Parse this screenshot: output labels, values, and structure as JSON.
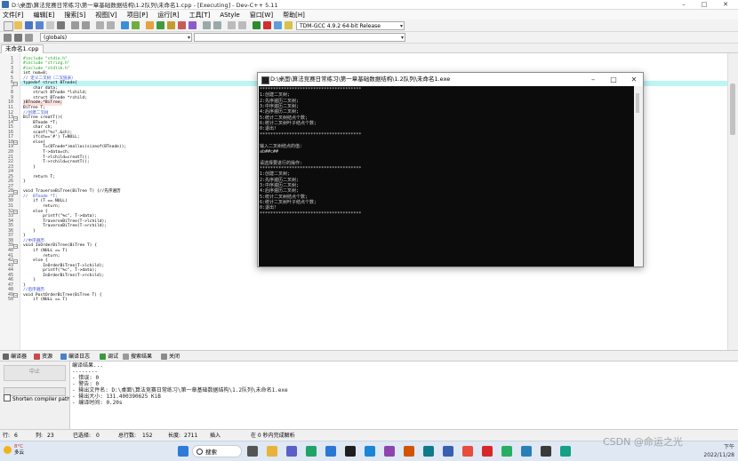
{
  "window": {
    "title": "D:\\桌面\\算法竞赛日常练习\\第一章基础数据结构\\1.2队列\\未命名1.cpp - [Executing] - Dev-C++ 5.11"
  },
  "menu": [
    "文件[F]",
    "编辑[E]",
    "搜索[S]",
    "视图[V]",
    "项目[P]",
    "运行[R]",
    "工具[T]",
    "AStyle",
    "窗口[W]",
    "帮助[H]"
  ],
  "toolbar": {
    "compiler": "TDM-GCC 4.9.2 64-bit Release",
    "scope": "(globals)"
  },
  "file_tab": "未命名1.cpp",
  "editor": {
    "lines": [
      {
        "n": "1",
        "t": "#include \"stdio.h\"",
        "c": "pp"
      },
      {
        "n": "2",
        "t": "#include \"string.h\"",
        "c": "pp"
      },
      {
        "n": "3",
        "t": "#include \"stdlib.h\"",
        "c": "pp"
      },
      {
        "n": "4",
        "t": "int num=0;",
        "c": ""
      },
      {
        "n": "5",
        "t": "// 定义二叉树（二叉链表）",
        "c": "cmt"
      },
      {
        "n": "6",
        "t": "typedef struct BTnode{",
        "c": "hl"
      },
      {
        "n": "7",
        "t": "    char data;",
        "c": ""
      },
      {
        "n": "8",
        "t": "    struct BTnode *lchild;",
        "c": ""
      },
      {
        "n": "9",
        "t": "    struct BTnode *rchild;",
        "c": ""
      },
      {
        "n": "10",
        "t": "}BTnode,*BiTree;",
        "c": "bp"
      },
      {
        "n": "11",
        "t": "BiTree T;",
        "c": ""
      },
      {
        "n": "12",
        "t": "//创建二叉树",
        "c": "cmt"
      },
      {
        "n": "13",
        "t": "BiTree creatT(){",
        "c": ""
      },
      {
        "n": "14",
        "t": "    BTnode *T;",
        "c": ""
      },
      {
        "n": "15",
        "t": "    char ch;",
        "c": ""
      },
      {
        "n": "16",
        "t": "    scanf(\"%c\",&ch);",
        "c": ""
      },
      {
        "n": "17",
        "t": "    if(ch=='#') T=NULL;",
        "c": ""
      },
      {
        "n": "18",
        "t": "    else{",
        "c": ""
      },
      {
        "n": "19",
        "t": "        T=(BTnode*)malloc(sizeof(BTnode));",
        "c": ""
      },
      {
        "n": "20",
        "t": "        T->data=ch;",
        "c": ""
      },
      {
        "n": "21",
        "t": "        T->lchild=creatT();",
        "c": ""
      },
      {
        "n": "22",
        "t": "        T->rchild=creatT();",
        "c": ""
      },
      {
        "n": "23",
        "t": "    }",
        "c": ""
      },
      {
        "n": "24",
        "t": "",
        "c": ""
      },
      {
        "n": "25",
        "t": "    return T;",
        "c": ""
      },
      {
        "n": "26",
        "t": "}",
        "c": ""
      },
      {
        "n": "27",
        "t": "",
        "c": ""
      },
      {
        "n": "28",
        "t": "void TraverseBiTree(BiTree T) {//先序遍历",
        "c": ""
      },
      {
        "n": "29",
        "t": "//  BTnode *T;",
        "c": "cmt"
      },
      {
        "n": "30",
        "t": "    if (T == NULL)",
        "c": ""
      },
      {
        "n": "31",
        "t": "        return;",
        "c": ""
      },
      {
        "n": "32",
        "t": "    else {",
        "c": ""
      },
      {
        "n": "33",
        "t": "        printf(\"%c\", T->data);",
        "c": ""
      },
      {
        "n": "34",
        "t": "        TraverseBiTree(T->lchild);",
        "c": ""
      },
      {
        "n": "35",
        "t": "        TraverseBiTree(T->rchild);",
        "c": ""
      },
      {
        "n": "36",
        "t": "    }",
        "c": ""
      },
      {
        "n": "37",
        "t": "}",
        "c": ""
      },
      {
        "n": "38",
        "t": "//中序遍历",
        "c": "cmt"
      },
      {
        "n": "39",
        "t": "void InOrderBiTree(BiTree T) {",
        "c": ""
      },
      {
        "n": "40",
        "t": "    if (NULL == T)",
        "c": ""
      },
      {
        "n": "41",
        "t": "        return;",
        "c": ""
      },
      {
        "n": "42",
        "t": "    else {",
        "c": ""
      },
      {
        "n": "43",
        "t": "        InOrderBiTree(T->lchild);",
        "c": ""
      },
      {
        "n": "44",
        "t": "        printf(\"%c\", T->data);",
        "c": ""
      },
      {
        "n": "45",
        "t": "        InOrderBiTree(T->rchild);",
        "c": ""
      },
      {
        "n": "46",
        "t": "    }",
        "c": ""
      },
      {
        "n": "47",
        "t": "}",
        "c": ""
      },
      {
        "n": "48",
        "t": "//后序遍历",
        "c": "cmt"
      },
      {
        "n": "49",
        "t": "void PostOrderBiTree(BiTree T) {",
        "c": ""
      },
      {
        "n": "50",
        "t": "    if (NULL == T)",
        "c": ""
      }
    ]
  },
  "console": {
    "title": "D:\\桌面\\算法竞赛日常练习\\第一章基础数据结构\\1.2队列\\未命名1.exe",
    "lines": [
      "**************************************",
      "1:创建二叉树;",
      "2:先序遍历二叉树;",
      "3:中序遍历二叉树;",
      "4:后序遍历二叉树;",
      "5:统计二叉树结点个数;",
      "6:统计二叉树叶子结点个数;",
      "0:退出!",
      "**************************************",
      "",
      "输入二叉树结点的值:",
      "ab##c##",
      "",
      "请选择要进行的操作:",
      "**************************************",
      "1:创建二叉树;",
      "2:先序遍历二叉树;",
      "3:中序遍历二叉树;",
      "4:后序遍历二叉树;",
      "5:统计二叉树结点个数;",
      "6:统计二叉树叶子结点个数;",
      "0:退出!",
      "**************************************"
    ]
  },
  "bottom_tabs": [
    "编译器",
    "资源",
    "编译日志",
    "调试",
    "搜索结果",
    "关闭"
  ],
  "bottom_panel": {
    "stop_button": "中止",
    "shorten_label": "Shorten compiler paths",
    "output_lines": [
      "编译结果...",
      "--------",
      "- 错误: 0",
      "- 警告: 0",
      "- 输出文件名: D:\\桌面\\算法竞赛日常练习\\第一章基础数据结构\\1.2队列\\未命名1.exe",
      "- 输出大小: 131.400390625 KiB",
      "- 编译时间: 0.20s"
    ]
  },
  "status_bar": {
    "row_label": "行:",
    "row": "6",
    "col_label": "列:",
    "col": "23",
    "selected_label": "已选择:",
    "selected": "0",
    "total_label": "总行数:",
    "total": "152",
    "length_label": "长度:",
    "length": "2711",
    "mode": "插入",
    "parse": "在 0 秒内完成解析"
  },
  "taskbar": {
    "weather_temp": "8°C",
    "weather_cond": "多云",
    "search_label": "搜索",
    "time": "下午",
    "date": "2022/11/28"
  },
  "watermark": "CSDN @命运之光"
}
